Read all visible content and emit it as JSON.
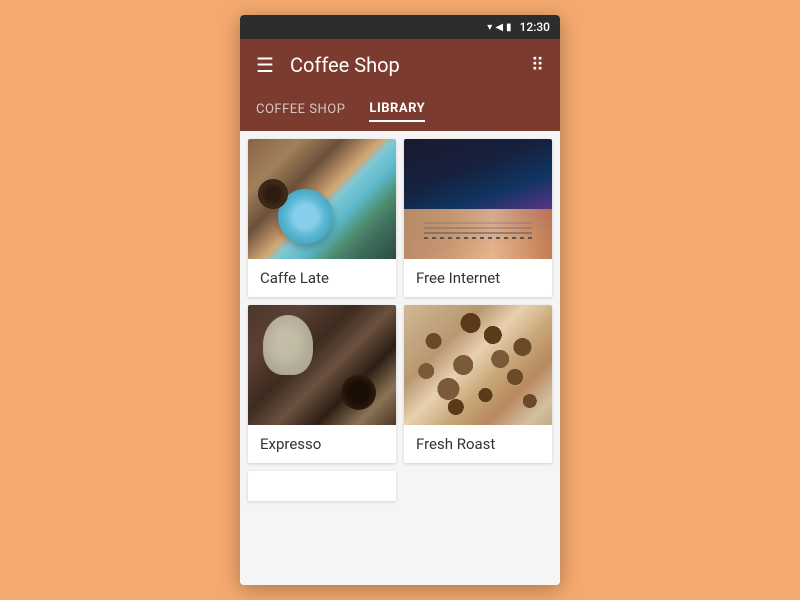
{
  "status_bar": {
    "time": "12:30",
    "wifi_icon": "▼",
    "signal_icon": "◀",
    "battery_icon": "▮"
  },
  "header": {
    "title": "Coffee Shop",
    "hamburger_icon": "☰",
    "grid_icon": "⠿"
  },
  "tabs": [
    {
      "label": "Coffee Shop",
      "active": false
    },
    {
      "label": "Library",
      "active": true
    }
  ],
  "cards": [
    {
      "id": "caffe-late",
      "label": "Caffe Late",
      "image_type": "caffe-late"
    },
    {
      "id": "free-internet",
      "label": "Free Internet",
      "image_type": "free-internet"
    },
    {
      "id": "expresso",
      "label": "Expresso",
      "image_type": "expresso"
    },
    {
      "id": "fresh-roast",
      "label": "Fresh Roast",
      "image_type": "fresh-roast"
    }
  ],
  "colors": {
    "header_bg": "#7B3B2E",
    "page_bg": "#F4A96F"
  }
}
